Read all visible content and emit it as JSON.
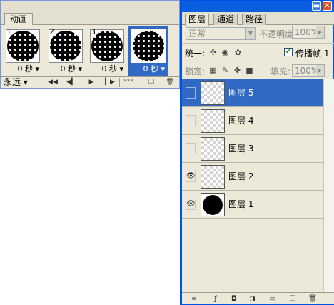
{
  "animation": {
    "tab_label": "动画",
    "frames": [
      {
        "num": "1",
        "delay": "0 秒"
      },
      {
        "num": "2",
        "delay": "0 秒"
      },
      {
        "num": "3",
        "delay": "0 秒"
      },
      {
        "num": "4",
        "delay": "0 秒"
      }
    ],
    "selected_frame": 4,
    "loop_value": "永远"
  },
  "layers_window": {
    "tabs": [
      "图层",
      "通道",
      "路径"
    ],
    "active_tab": "图层",
    "blend_mode": "正常",
    "opacity_label": "不透明度:",
    "opacity_value": "100%",
    "unify_label": "统一:",
    "propagate_label": "传播帧 1",
    "propagate_checked": true,
    "lock_label": "锁定:",
    "fill_label": "填充:",
    "fill_value": "100%",
    "layers": [
      {
        "name": "图层 5",
        "visible": false,
        "selected": true,
        "thumb": "transparent"
      },
      {
        "name": "图层 4",
        "visible": false,
        "selected": false,
        "thumb": "transparent"
      },
      {
        "name": "图层 3",
        "visible": false,
        "selected": false,
        "thumb": "transparent"
      },
      {
        "name": "图层 2",
        "visible": true,
        "selected": false,
        "thumb": "transparent"
      },
      {
        "name": "图层 1",
        "visible": true,
        "selected": false,
        "thumb": "black-circle"
      }
    ],
    "eye_glyph": "👁"
  },
  "colors": {
    "selection": "#316ac5",
    "panel": "#ece9d8",
    "titlebar": "#0a5fe0"
  }
}
